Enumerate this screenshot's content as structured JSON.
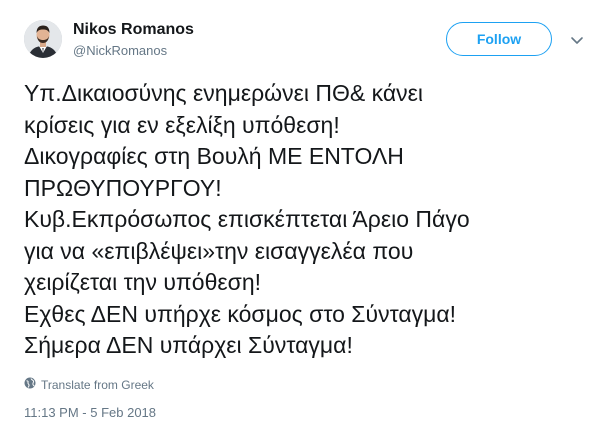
{
  "author": {
    "display_name": "Nikos Romanos",
    "handle": "@NickRomanos",
    "avatar_icon": "user-avatar-photo"
  },
  "actions": {
    "follow_label": "Follow",
    "more_icon": "chevron-down-icon"
  },
  "tweet": {
    "text": "Υπ.Δικαιοσύνης ενημερώνει ΠΘ& κάνει\nκρίσεις για εν εξελίξη υπόθεση!\nΔικογραφίες στη Βουλή ΜΕ ΕΝΤΟΛΗ\nΠΡΩΘΥΠΟΥΡΓΟΥ!\nΚυβ.Εκπρόσωπος επισκέπτεται Άρειο Πάγο\nγια να «επιβλέψει»την εισαγγελέα που\nχειρίζεται την υπόθεση!\nΕχθες ΔΕΝ υπήρχε κόσμος στο Σύνταγμα!\nΣήμερα ΔΕΝ υπάρχει Σύνταγμα!",
    "translate_label": "Translate from Greek",
    "translate_icon": "globe-icon",
    "timestamp": "11:13 PM - 5 Feb 2018"
  },
  "colors": {
    "accent": "#1da1f2",
    "text": "#14171a",
    "secondary": "#657786"
  }
}
